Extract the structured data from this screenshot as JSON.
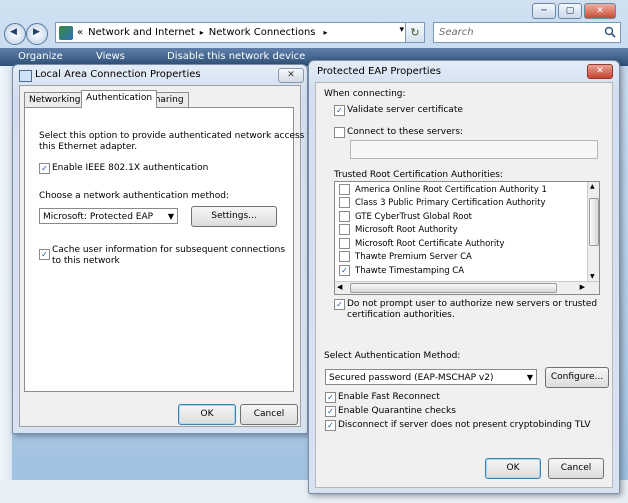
{
  "explorer": {
    "back_glyph": "◀",
    "forward_glyph": "▶",
    "address_chevrons": "«",
    "address_path": [
      "Network and Internet",
      "Network Connections"
    ],
    "address_sep": "▸",
    "address_refresh": "↻",
    "address_dropdown": "▾",
    "search_placeholder": "Search",
    "command_bar": [
      "Organize",
      "Views",
      "Disable this network device"
    ],
    "window_controls": {
      "minimize": "─",
      "maximize": "▢",
      "close": "✕"
    }
  },
  "lan_dialog": {
    "title": "Local Area Connection Properties",
    "close": "✕",
    "tabs": [
      "Networking",
      "Authentication",
      "Sharing"
    ],
    "description": [
      "Select this option to provide authenticated network access for",
      "this Ethernet adapter."
    ],
    "enable_8021x": {
      "label": "Enable IEEE 802.1X authentication",
      "checked": true
    },
    "method_label": "Choose a network authentication method:",
    "method_value": "Microsoft: Protected EAP (PEAP)",
    "settings_button": "Settings...",
    "cache_user": {
      "label": [
        "Cache user information for subsequent connections",
        "to this network"
      ],
      "checked": true
    },
    "ok": "OK",
    "cancel": "Cancel"
  },
  "peap_dialog": {
    "title": "Protected EAP Properties",
    "close": "✕",
    "when_connecting": "When connecting:",
    "validate_cert": {
      "label": "Validate server certificate",
      "checked": true
    },
    "connect_servers": {
      "label": "Connect to these servers:",
      "checked": false
    },
    "servers_value": "",
    "trusted_ca_label": "Trusted Root Certification Authorities:",
    "certificates": [
      {
        "name": "America Online Root Certification Authority 1",
        "checked": false
      },
      {
        "name": "Class 3 Public Primary Certification Authority",
        "checked": false
      },
      {
        "name": "GTE CyberTrust Global Root",
        "checked": false
      },
      {
        "name": "Microsoft Root Authority",
        "checked": false
      },
      {
        "name": "Microsoft Root Certificate Authority",
        "checked": false
      },
      {
        "name": "Thawte Premium Server CA",
        "checked": false
      },
      {
        "name": "Thawte Timestamping CA",
        "checked": true
      }
    ],
    "no_prompt": {
      "label": [
        "Do not prompt user to authorize new servers or trusted",
        "certification authorities."
      ],
      "checked": true
    },
    "auth_method_label": "Select Authentication Method:",
    "auth_method_value": "Secured password (EAP-MSCHAP v2)",
    "configure_button": "Configure...",
    "fast_reconnect": {
      "label": "Enable Fast Reconnect",
      "checked": true
    },
    "quarantine": {
      "label": "Enable Quarantine checks",
      "checked": true
    },
    "disconnect_tlv": {
      "label": "Disconnect if server does not present cryptobinding TLV",
      "checked": true
    },
    "ok": "OK",
    "cancel": "Cancel"
  }
}
